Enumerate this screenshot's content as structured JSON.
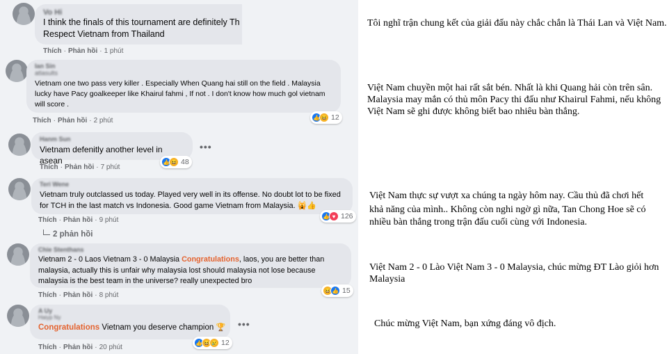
{
  "comments": [
    {
      "author": "Vo Hi",
      "text1": "I think the finals of this tournament are definitely Th",
      "text2": "Respect Vietnam from Thailand",
      "like_label": "Thích",
      "reply_label": "Phản hồi",
      "time": "1 phút"
    },
    {
      "author": "Ian Sin",
      "author_sub": "atlasults",
      "text": "Vietnam one two pass very killer . Especially When Quang hai still on the field . Malaysia lucky have Pacy goalkeeper like Khairul fahmi , If not . I don't know how much gol vietnam will score .",
      "like_label": "Thích",
      "reply_label": "Phản hồi",
      "time": "2 phút",
      "reactions": [
        "like-icon",
        "haha-icon"
      ],
      "reaction_count": "12"
    },
    {
      "author": "Hanm Sun",
      "text": "Vietnam defenitly another level in asean",
      "like_label": "Thích",
      "reply_label": "Phản hồi",
      "time": "7 phút",
      "reactions": [
        "like-icon",
        "haha-icon"
      ],
      "reaction_count": "48",
      "more_label": "•••"
    },
    {
      "author": "Teri Wene",
      "text": "Vietnam truly outclassed us today. Played very well in its offense. No doubt lot to be fixed for TCH in the last match vs Indonesia. Good game Vietnam from Malaysia.",
      "emoji": "🙀👍",
      "like_label": "Thích",
      "reply_label": "Phản hồi",
      "time": "9 phút",
      "reactions": [
        "like-icon",
        "love-icon"
      ],
      "reaction_count": "126",
      "replies_label": "2 phản hồi"
    },
    {
      "author": "Chie Stenthans",
      "text_before": "Vietnam 2 - 0 Laos Vietnam 3 - 0 Malaysia ",
      "text_highlight": "Congratulations",
      "text_after": ", laos, you are better than malaysia, actually this is unfair why malaysia lost should malaysia not lose because malaysia is the best team in the universe? really unexpected bro",
      "like_label": "Thích",
      "reply_label": "Phản hồi",
      "time": "8 phút",
      "reactions": [
        "haha-icon",
        "like-icon"
      ],
      "reaction_count": "15"
    },
    {
      "author": "A Uy",
      "author_sub": "Haiyp Ny",
      "text_highlight": "Congratulations",
      "text_after": " Vietnam you deserve champion ",
      "emoji": "🏆",
      "like_label": "Thích",
      "reply_label": "Phản hồi",
      "time": "20 phút",
      "reactions": [
        "like-icon",
        "haha-icon",
        "sad-icon"
      ],
      "reaction_count": "12",
      "more_label": "•••"
    }
  ],
  "translations": [
    "Tôi nghĩ trận chung kết của giải đấu này chắc chắn là Thái Lan và Việt Nam.",
    "Việt Nam chuyền một hai rất sắt bén. Nhất là khi Quang hải còn trên sân.",
    "Malaysia may mắn có thủ môn Pacy thi đấu như Khairul Fahmi, nếu không",
    "Việt Nam sẽ ghi được không biết bao nhiêu bàn thắng.",
    "Việt Nam thực sự vượt xa chúng ta ngày hôm nay. Cầu thủ đã chơi hết",
    "khả năng của mình.. Không còn nghi ngờ gì nữa, Tan Chong Hoe sẽ có",
    "nhiều bàn thắng trong trận đấu cuối cùng với Indonesia.",
    "Việt Nam 2 - 0 Lào Việt Nam 3 - 0 Malaysia, chúc mừng ĐT Lào giỏi hơn",
    "Malaysia",
    "Chúc mừng Việt Nam, bạn xứng đáng vô địch."
  ],
  "colors": {
    "bubble": "#e4e6eb",
    "panel": "#f0f2f5",
    "meta": "#65676b",
    "highlight": "#e4632f",
    "like": "#1877f2",
    "love": "#f33e58",
    "haha": "#f7b125"
  }
}
